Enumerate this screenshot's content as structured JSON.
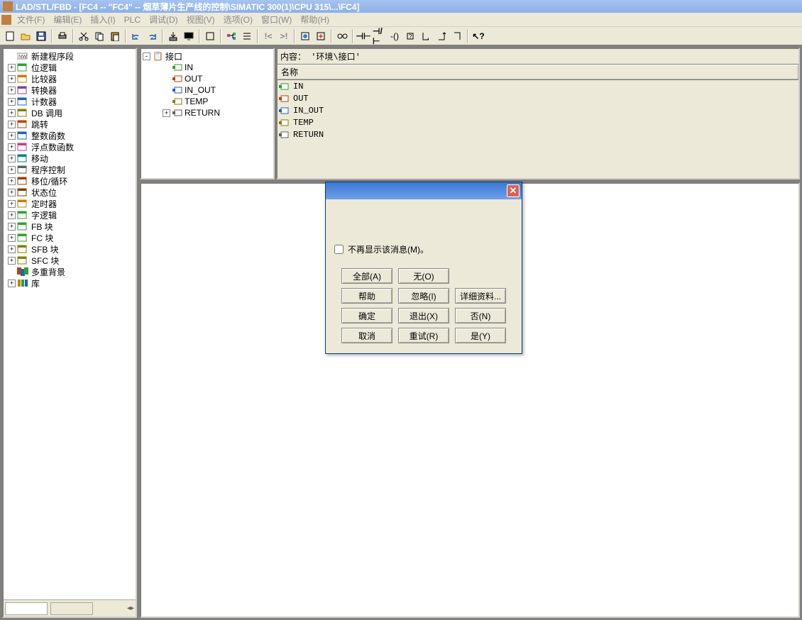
{
  "title": "LAD/STL/FBD  - [FC4 -- \"FC4\" -- 烟草薄片生产线的控制\\SIMATIC 300(1)\\CPU 315\\...\\FC4]",
  "menu": {
    "items": [
      {
        "label": "文件(F)"
      },
      {
        "label": "编辑(E)"
      },
      {
        "label": "插入(I)"
      },
      {
        "label": "PLC"
      },
      {
        "label": "调试(D)"
      },
      {
        "label": "视图(V)"
      },
      {
        "label": "选项(O)"
      },
      {
        "label": "窗口(W)"
      },
      {
        "label": "帮助(H)"
      }
    ]
  },
  "tree": {
    "items": [
      {
        "exp": "",
        "icon": "new",
        "label": "新建程序段"
      },
      {
        "exp": "+",
        "icon": "blk",
        "label": "位逻辑"
      },
      {
        "exp": "+",
        "icon": "cmp",
        "label": "比较器"
      },
      {
        "exp": "+",
        "icon": "cnv",
        "label": "转换器"
      },
      {
        "exp": "+",
        "icon": "cnt",
        "label": "计数器"
      },
      {
        "exp": "+",
        "icon": "db",
        "label": "DB 调用"
      },
      {
        "exp": "+",
        "icon": "jmp",
        "label": "跳转"
      },
      {
        "exp": "+",
        "icon": "int",
        "label": "整数函数"
      },
      {
        "exp": "+",
        "icon": "flt",
        "label": "浮点数函数"
      },
      {
        "exp": "+",
        "icon": "mov",
        "label": "移动"
      },
      {
        "exp": "+",
        "icon": "prg",
        "label": "程序控制"
      },
      {
        "exp": "+",
        "icon": "shf",
        "label": "移位/循环"
      },
      {
        "exp": "+",
        "icon": "sta",
        "label": "状态位"
      },
      {
        "exp": "+",
        "icon": "tmr",
        "label": "定时器"
      },
      {
        "exp": "+",
        "icon": "blk",
        "label": "字逻辑"
      },
      {
        "exp": "+",
        "icon": "fb",
        "label": "FB 块"
      },
      {
        "exp": "+",
        "icon": "fc",
        "label": "FC 块"
      },
      {
        "exp": "+",
        "icon": "sfb",
        "label": "SFB 块"
      },
      {
        "exp": "+",
        "icon": "sfc",
        "label": "SFC 块"
      },
      {
        "exp": "",
        "icon": "multi",
        "label": "多重背景"
      },
      {
        "exp": "+",
        "icon": "lib",
        "label": "库"
      }
    ]
  },
  "interface": {
    "root": "接口",
    "children": [
      {
        "exp": "",
        "dir": "in",
        "label": "IN"
      },
      {
        "exp": "",
        "dir": "out",
        "label": "OUT"
      },
      {
        "exp": "",
        "dir": "inout",
        "label": "IN_OUT"
      },
      {
        "exp": "",
        "dir": "temp",
        "label": "TEMP"
      },
      {
        "exp": "+",
        "dir": "ret",
        "label": "RETURN"
      }
    ]
  },
  "details": {
    "header": "内容：  '环境\\接口'",
    "col": "名称",
    "rows": [
      {
        "dir": "in",
        "label": "IN"
      },
      {
        "dir": "out",
        "label": "OUT"
      },
      {
        "dir": "inout",
        "label": "IN_OUT"
      },
      {
        "dir": "temp",
        "label": "TEMP"
      },
      {
        "dir": "ret",
        "label": "RETURN"
      }
    ]
  },
  "dialog": {
    "checkbox": "不再显示该消息(M)。",
    "buttons": {
      "all": "全部(A)",
      "none": "无(O)",
      "help": "帮助",
      "ignore": "忽略(I)",
      "details": "详细资料...",
      "ok": "确定",
      "exit": "退出(X)",
      "no": "否(N)",
      "cancel": "取消",
      "retry": "重试(R)",
      "yes": "是(Y)"
    }
  }
}
